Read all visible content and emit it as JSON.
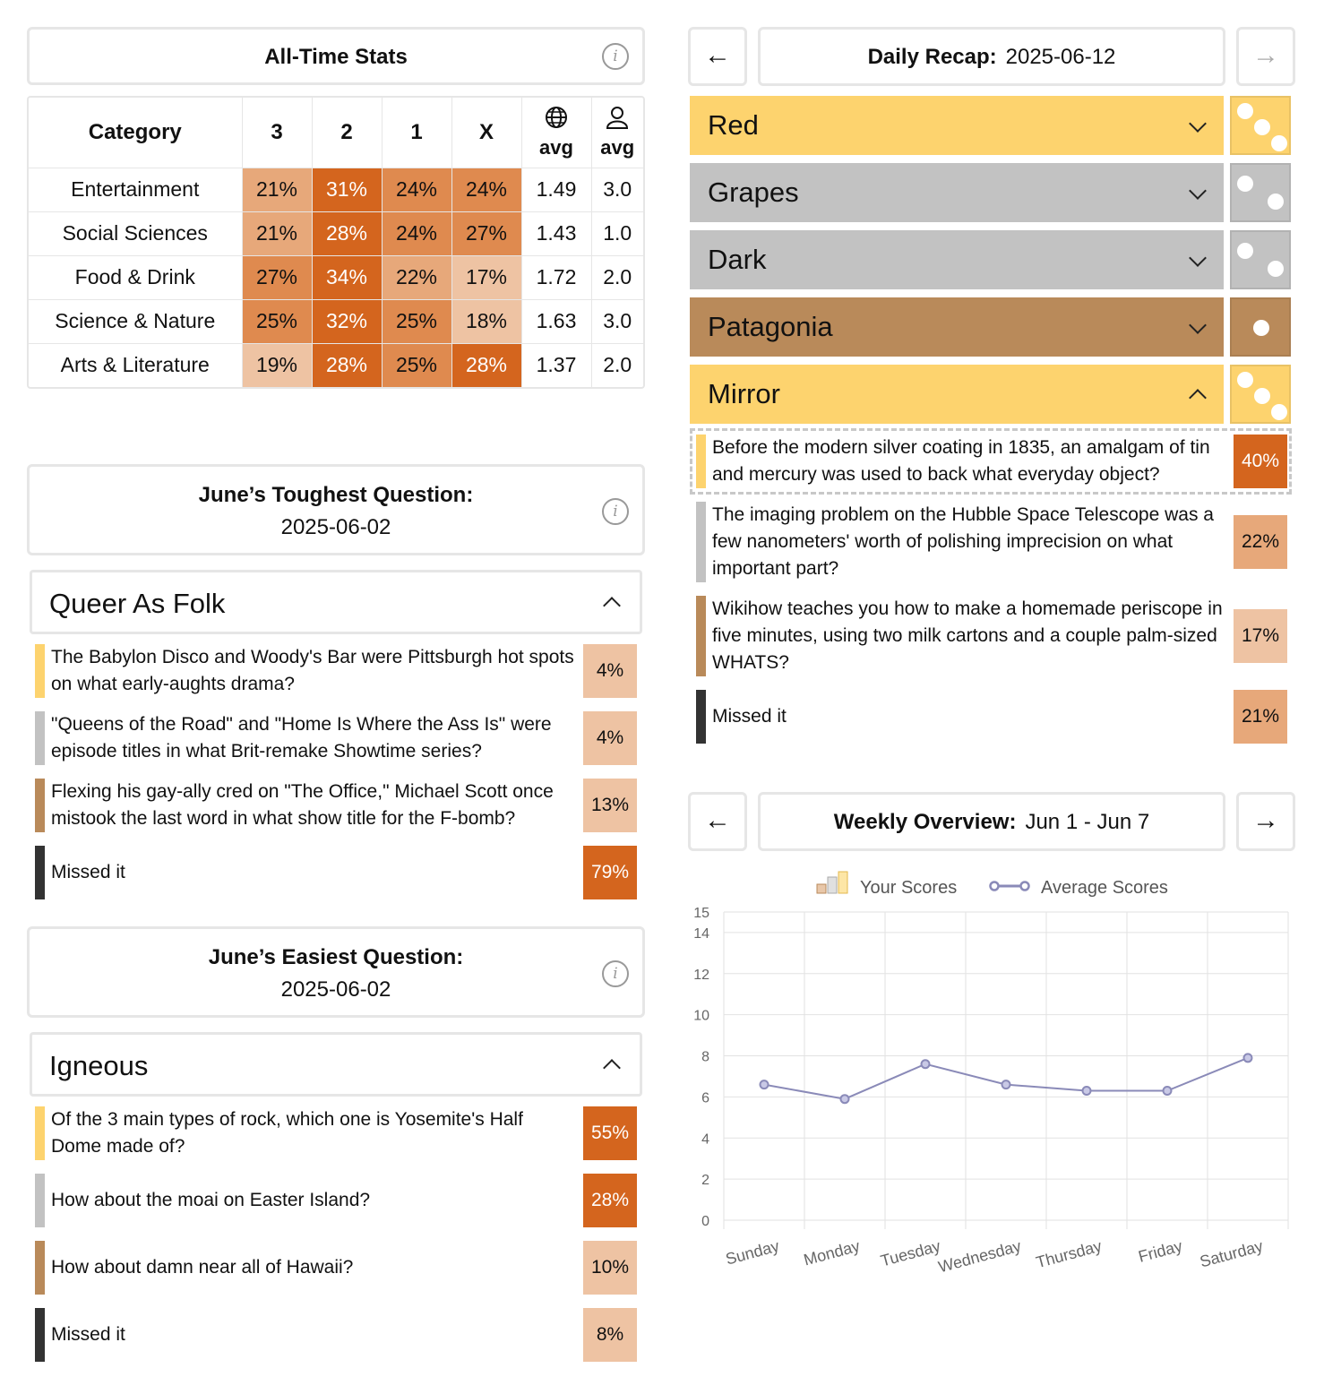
{
  "stats": {
    "title": "All-Time Stats",
    "columns": [
      "Category",
      "3",
      "2",
      "1",
      "X"
    ],
    "avg_label": "avg",
    "globe_icon": "globe-icon",
    "user_icon": "user-icon",
    "rows": [
      {
        "category": "Entertainment",
        "p3": "21%",
        "p2": "31%",
        "p1": "24%",
        "px": "24%",
        "global_avg": "1.49",
        "user_avg": "3.0"
      },
      {
        "category": "Social Sciences",
        "p3": "21%",
        "p2": "28%",
        "p1": "24%",
        "px": "27%",
        "global_avg": "1.43",
        "user_avg": "1.0"
      },
      {
        "category": "Food & Drink",
        "p3": "27%",
        "p2": "34%",
        "p1": "22%",
        "px": "17%",
        "global_avg": "1.72",
        "user_avg": "2.0"
      },
      {
        "category": "Science & Nature",
        "p3": "25%",
        "p2": "32%",
        "p1": "25%",
        "px": "18%",
        "global_avg": "1.63",
        "user_avg": "3.0"
      },
      {
        "category": "Arts & Literature",
        "p3": "19%",
        "p2": "28%",
        "p1": "25%",
        "px": "28%",
        "global_avg": "1.37",
        "user_avg": "2.0"
      }
    ]
  },
  "toughest": {
    "title": "June’s Toughest Question:",
    "date": "2025-06-02",
    "category": "Queer As Folk",
    "questions": [
      {
        "text": "The Babylon Disco and Woody's Bar were Pittsburgh hot spots on what early-aughts drama?",
        "pct": "4%"
      },
      {
        "text": "\"Queens of the Road\" and \"Home Is Where the Ass Is\" were episode titles in what Brit-remake Showtime series?",
        "pct": "4%"
      },
      {
        "text": "Flexing his gay-ally cred on \"The Office,\" Michael Scott once mistook the last word in what show title for the F-bomb?",
        "pct": "13%"
      },
      {
        "text": "Missed it",
        "pct": "79%"
      }
    ]
  },
  "easiest": {
    "title": "June’s Easiest Question:",
    "date": "2025-06-02",
    "category": "Igneous",
    "questions": [
      {
        "text": "Of the 3 main types of rock, which one is Yosemite's Half Dome made of?",
        "pct": "55%"
      },
      {
        "text": "How about the moai on Easter Island?",
        "pct": "28%"
      },
      {
        "text": "How about damn near all of Hawaii?",
        "pct": "10%"
      },
      {
        "text": "Missed it",
        "pct": "8%"
      }
    ]
  },
  "daily": {
    "title_label": "Daily Recap:",
    "date": "2025-06-12",
    "prev_icon": "←",
    "next_icon": "→",
    "categories": [
      {
        "name": "Red",
        "expanded": false,
        "score": 3
      },
      {
        "name": "Grapes",
        "expanded": false,
        "score": 2
      },
      {
        "name": "Dark",
        "expanded": false,
        "score": 2
      },
      {
        "name": "Patagonia",
        "expanded": false,
        "score": 1
      },
      {
        "name": "Mirror",
        "expanded": true,
        "score": 3
      }
    ],
    "questions": [
      {
        "text": "Before the modern silver coating in 1835, an amalgam of tin and mercury was used to back what everyday object?",
        "pct": "40%"
      },
      {
        "text": "The imaging problem on the Hubble Space Telescope was a few nanometers' worth of polishing imprecision on what important part?",
        "pct": "22%"
      },
      {
        "text": "Wikihow teaches you how to make a homemade periscope in five minutes, using two milk cartons and a couple palm-sized WHATS?",
        "pct": "17%"
      },
      {
        "text": "Missed it",
        "pct": "21%"
      }
    ]
  },
  "weekly": {
    "title_label": "Weekly Overview:",
    "range": "Jun 1 - Jun 7",
    "prev_icon": "←",
    "next_icon": "→"
  },
  "colors": {
    "gold": "#FDD36E",
    "silver": "#C2C2C2",
    "bronze": "#B98A5A",
    "missed": "#333333",
    "heat_dark": "#D4651E",
    "heat_mid": "#DF8A4F",
    "heat_light": "#E7A87A",
    "heat_pale": "#EEC3A3",
    "line": "#8A8AB8"
  },
  "chart_data": {
    "type": "line",
    "categories": [
      "Sunday",
      "Monday",
      "Tuesday",
      "Wednesday",
      "Thursday",
      "Friday",
      "Saturday"
    ],
    "series": [
      {
        "name": "Your Scores",
        "type": "bar",
        "values": [
          null,
          null,
          null,
          null,
          null,
          null,
          null
        ]
      },
      {
        "name": "Average Scores",
        "type": "line",
        "values": [
          6.6,
          5.9,
          7.6,
          6.6,
          6.3,
          6.3,
          7.9
        ]
      }
    ],
    "yticks": [
      0,
      2,
      4,
      6,
      8,
      10,
      12,
      14,
      15
    ],
    "ylim": [
      0,
      15
    ],
    "grid": true,
    "legend": "top-center"
  }
}
